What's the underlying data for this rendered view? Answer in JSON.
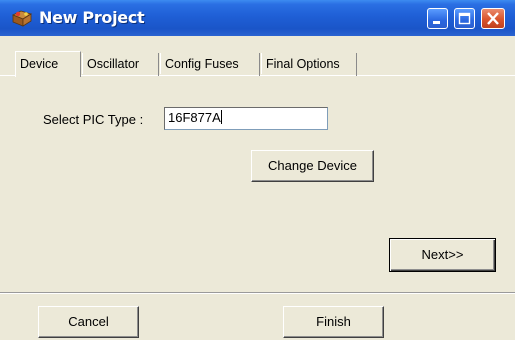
{
  "window": {
    "title": "New Project",
    "app_icon": "project-wizard-icon",
    "controls": {
      "minimize_icon": "minimize-icon",
      "maximize_icon": "maximize-icon",
      "close_icon": "close-icon"
    },
    "title_bar_color": "#1f5fd6",
    "close_button_color": "#d9542c",
    "dialog_background": "#ece9d8"
  },
  "tabs": [
    {
      "label": "Device",
      "selected": true
    },
    {
      "label": "Oscillator",
      "selected": false
    },
    {
      "label": "Config Fuses",
      "selected": false
    },
    {
      "label": "Final Options",
      "selected": false
    }
  ],
  "device": {
    "select_label": "Select PIC Type :",
    "pic_type_value": "16F877A",
    "change_device_label": "Change Device",
    "next_label": "Next>>"
  },
  "footer": {
    "cancel_label": "Cancel",
    "finish_label": "Finish"
  }
}
